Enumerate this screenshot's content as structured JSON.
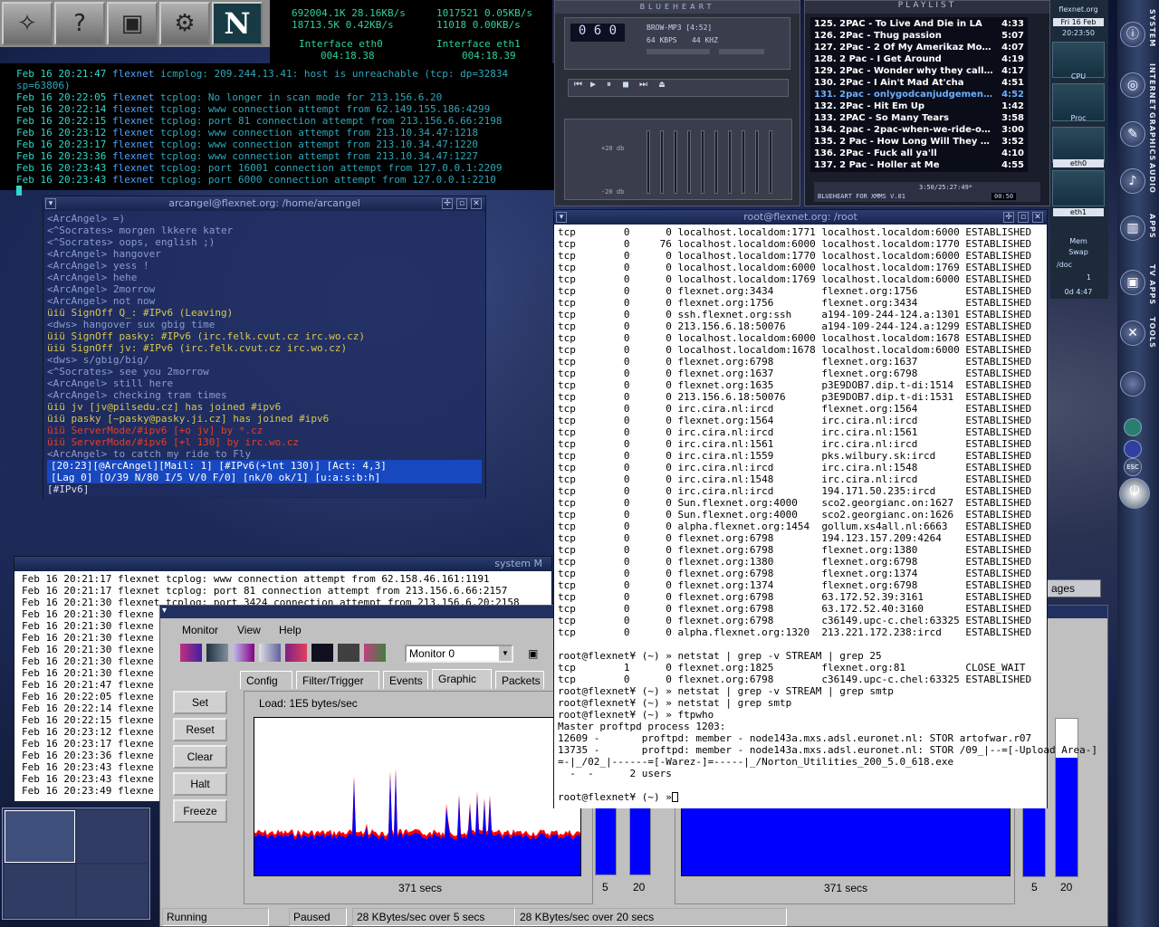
{
  "launcher": {
    "items": [
      {
        "icon": "foot-icon",
        "glyph": "✧"
      },
      {
        "icon": "help-icon",
        "glyph": "?"
      },
      {
        "icon": "terminal-icon",
        "glyph": "▣"
      },
      {
        "icon": "settings-icon",
        "glyph": "⚙"
      },
      {
        "icon": "netscape-icon",
        "glyph": "N"
      }
    ]
  },
  "netmon": {
    "eth0": {
      "l1": "692004.1K   28.16KB/s",
      "l2": "18713.5K   0.42KB/s",
      "label": "Interface  eth0",
      "time": "004:18.38"
    },
    "eth1": {
      "l1": "1017521   0.05KB/s",
      "l2": "11018   0.00KB/s",
      "label": "Interface  eth1",
      "time": "004:18.39"
    }
  },
  "tcplog": [
    {
      "d": "Feb 16 20:21:47",
      "h": "flexnet",
      "m": "icmplog: 209.244.13.41: host is unreachable (tcp: dp=32834 sp=63806)"
    },
    {
      "d": "Feb 16 20:22:05",
      "h": "flexnet",
      "m": "tcplog: No longer in scan mode for 213.156.6.20"
    },
    {
      "d": "Feb 16 20:22:14",
      "h": "flexnet",
      "m": "tcplog: www connection attempt from 62.149.155.186:4299"
    },
    {
      "d": "Feb 16 20:22:15",
      "h": "flexnet",
      "m": "tcplog: port 81 connection attempt from 213.156.6.66:2198"
    },
    {
      "d": "Feb 16 20:23:12",
      "h": "flexnet",
      "m": "tcplog: www connection attempt from 213.10.34.47:1218"
    },
    {
      "d": "Feb 16 20:23:17",
      "h": "flexnet",
      "m": "tcplog: www connection attempt from 213.10.34.47:1220"
    },
    {
      "d": "Feb 16 20:23:36",
      "h": "flexnet",
      "m": "tcplog: www connection attempt from 213.10.34.47:1227"
    },
    {
      "d": "Feb 16 20:23:43",
      "h": "flexnet",
      "m": "tcplog: port 16001 connection attempt from 127.0.0.1:2209"
    },
    {
      "d": "Feb 16 20:23:43",
      "h": "flexnet",
      "m": "tcplog: port 6000 connection attempt from 127.0.0.1:2210"
    }
  ],
  "irc": {
    "title": "arcangel@flexnet.org: /home/arcangel",
    "lines": [
      {
        "c": "nick",
        "t": "<ArcAngel> =)"
      },
      {
        "c": "nick",
        "t": "<^Socrates> morgen lkkere kater"
      },
      {
        "c": "nick",
        "t": "<^Socrates> oops, english ;)"
      },
      {
        "c": "nick",
        "t": "<ArcAngel> hangover"
      },
      {
        "c": "nick",
        "t": "<ArcAngel> yess !"
      },
      {
        "c": "nick",
        "t": "<ArcAngel> hehe"
      },
      {
        "c": "nick",
        "t": "<ArcAngel> 2morrow"
      },
      {
        "c": "nick",
        "t": "<ArcAngel> not now"
      },
      {
        "c": "yel",
        "t": "üiü SignOff Q_: #IPv6 (Leaving)"
      },
      {
        "c": "nick",
        "t": "<dws> hangover sux gbig time"
      },
      {
        "c": "yel",
        "t": "üiü SignOff pasky: #IPv6 (irc.felk.cvut.cz irc.wo.cz)"
      },
      {
        "c": "yel",
        "t": "üiü SignOff jv: #IPv6 (irc.felk.cvut.cz irc.wo.cz)"
      },
      {
        "c": "nick",
        "t": "<dws> s/gbig/big/"
      },
      {
        "c": "nick",
        "t": "<^Socrates> see you 2morrow"
      },
      {
        "c": "nick",
        "t": "<ArcAngel> still here"
      },
      {
        "c": "nick",
        "t": "<ArcAngel> checking tram times"
      },
      {
        "c": "yel",
        "t": "üiü jv [jv@pilsedu.cz] has joined #ipv6"
      },
      {
        "c": "yel",
        "t": "üiü pasky [~pasky@pasky.ji.cz] has joined #ipv6"
      },
      {
        "c": "red",
        "t": "üiü ServerMode/#ipv6 [+o jv] by *.cz"
      },
      {
        "c": "red",
        "t": "üiü ServerMode/#ipv6 [+l 130] by irc.wo.cz"
      },
      {
        "c": "nick",
        "t": "<ArcAngel> to catch my ride to Fly"
      }
    ],
    "status1": " [20:23][@ArcAngel][Mail: 1] [#IPv6(+lnt 130)]   [Act: 4,3]",
    "status2": " [Lag  0] [O/39 N/80 I/5 V/0 F/0] [nk/0 ok/1]          [u:a:s:b:h]",
    "input": "[#IPv6] "
  },
  "root": {
    "title": "root@flexnet.org: /root",
    "netstat": [
      "tcp        0      0 localhost.localdom:1771 localhost.localdom:6000 ESTABLISHED",
      "tcp        0     76 localhost.localdom:6000 localhost.localdom:1770 ESTABLISHED",
      "tcp        0      0 localhost.localdom:1770 localhost.localdom:6000 ESTABLISHED",
      "tcp        0      0 localhost.localdom:6000 localhost.localdom:1769 ESTABLISHED",
      "tcp        0      0 localhost.localdom:1769 localhost.localdom:6000 ESTABLISHED",
      "tcp        0      0 flexnet.org:3434        flexnet.org:1756        ESTABLISHED",
      "tcp        0      0 flexnet.org:1756        flexnet.org:3434        ESTABLISHED",
      "tcp        0      0 ssh.flexnet.org:ssh     a194-109-244-124.a:1301 ESTABLISHED",
      "tcp        0      0 213.156.6.18:50076      a194-109-244-124.a:1299 ESTABLISHED",
      "tcp        0      0 localhost.localdom:6000 localhost.localdom:1678 ESTABLISHED",
      "tcp        0      0 localhost.localdom:1678 localhost.localdom:6000 ESTABLISHED",
      "tcp        0      0 flexnet.org:6798        flexnet.org:1637        ESTABLISHED",
      "tcp        0      0 flexnet.org:1637        flexnet.org:6798        ESTABLISHED",
      "tcp        0      0 flexnet.org:1635        p3E9DOB7.dip.t-di:1514  ESTABLISHED",
      "tcp        0      0 213.156.6.18:50076      p3E9DOB7.dip.t-di:1531  ESTABLISHED",
      "tcp        0      0 irc.cira.nl:ircd        flexnet.org:1564        ESTABLISHED",
      "tcp        0      0 flexnet.org:1564        irc.cira.nl:ircd        ESTABLISHED",
      "tcp        0      0 irc.cira.nl:ircd        irc.cira.nl:1561        ESTABLISHED",
      "tcp        0      0 irc.cira.nl:1561        irc.cira.nl:ircd        ESTABLISHED",
      "tcp        0      0 irc.cira.nl:1559        pks.wilbury.sk:ircd     ESTABLISHED",
      "tcp        0      0 irc.cira.nl:ircd        irc.cira.nl:1548        ESTABLISHED",
      "tcp        0      0 irc.cira.nl:1548        irc.cira.nl:ircd        ESTABLISHED",
      "tcp        0      0 irc.cira.nl:ircd        194.171.50.235:ircd     ESTABLISHED",
      "tcp        0      0 Sun.flexnet.org:4000    sco2.georgianc.on:1627  ESTABLISHED",
      "tcp        0      0 Sun.flexnet.org:4000    sco2.georgianc.on:1626  ESTABLISHED",
      "tcp        0      0 alpha.flexnet.org:1454  gollum.xs4all.nl:6663   ESTABLISHED",
      "tcp        0      0 flexnet.org:6798        194.123.157.209:4264    ESTABLISHED",
      "tcp        0      0 flexnet.org:6798        flexnet.org:1380        ESTABLISHED",
      "tcp        0      0 flexnet.org:1380        flexnet.org:6798        ESTABLISHED",
      "tcp        0      0 flexnet.org:6798        flexnet.org:1374        ESTABLISHED",
      "tcp        0      0 flexnet.org:1374        flexnet.org:6798        ESTABLISHED",
      "tcp        0      0 flexnet.org:6798        63.172.52.39:3161       ESTABLISHED",
      "tcp        0      0 flexnet.org:6798        63.172.52.40:3160       ESTABLISHED",
      "tcp        0      0 flexnet.org:6798        c36149.upc-c.chel:63325 ESTABLISHED",
      "tcp        0      0 alpha.flexnet.org:1320  213.221.172.238:ircd    ESTABLISHED",
      "",
      "root@flexnet¥ (~) » netstat | grep -v STREAM | grep 25",
      "tcp        1      0 flexnet.org:1825        flexnet.org:81          CLOSE_WAIT",
      "tcp        0      0 flexnet.org:6798        c36149.upc-c.chel:63325 ESTABLISHED",
      "root@flexnet¥ (~) » netstat | grep -v STREAM | grep smtp",
      "root@flexnet¥ (~) » netstat | grep smtp",
      "root@flexnet¥ (~) » ftpwho",
      "Master proftpd process 1203:",
      "12609 -       proftpd: member - node143a.mxs.adsl.euronet.nl: STOR artofwar.r07",
      "13735 -       proftpd: member - node143a.mxs.adsl.euronet.nl: STOR /09_|--=[-Upload Area-]",
      "=-|_/02_|------=[-Warez-]=-----|_/Norton_Utilities_200_5.0_618.exe",
      "  -  -      2 users",
      "",
      "root@flexnet¥ (~) » "
    ]
  },
  "sysmon": {
    "title": "system M",
    "lines": [
      "Feb 16 20:21:17 flexnet tcplog: www connection attempt from 62.158.46.161:1191",
      "Feb 16 20:21:17 flexnet tcplog: port 81 connection attempt from 213.156.6.66:2157",
      "Feb 16 20:21:30 flexnet tcplog: port 3424 connection attempt from 213.156.6.20:2158",
      "Feb 16 20:21:30 flexne",
      "Feb 16 20:21:30 flexne",
      "Feb 16 20:21:30 flexne",
      "Feb 16 20:21:30 flexne",
      "Feb 16 20:21:30 flexne",
      "Feb 16 20:21:30 flexne",
      "Feb 16 20:21:47 flexne",
      "Feb 16 20:22:05 flexne",
      "Feb 16 20:22:14 flexne",
      "Feb 16 20:22:15 flexne",
      "Feb 16 20:23:12 flexne",
      "Feb 16 20:23:17 flexne",
      "Feb 16 20:23:36 flexne",
      "Feb 16 20:23:43 flexne",
      "Feb 16 20:23:43 flexne",
      "Feb 16 20:23:49 flexne"
    ]
  },
  "monitor": {
    "menu": [
      "Monitor",
      "View",
      "Help"
    ],
    "select": "Monitor 0",
    "tabs": [
      "Config",
      "Filter/Trigger",
      "Events",
      "Graphic",
      "Packets"
    ],
    "active_tab": "Graphic",
    "buttons": [
      "Set",
      "Reset",
      "Clear",
      "Halt",
      "Freeze"
    ],
    "graph_label": "Load: 1E5 bytes/sec",
    "xlabel": "371 secs",
    "xlabel2": "371 secs",
    "bar_labels": [
      "5",
      "20"
    ],
    "bar_labels2": [
      "5",
      "20"
    ],
    "status": [
      "Running",
      "Paused",
      "28 KBytes/sec over 5 secs",
      "28 KBytes/sec over 20 secs"
    ],
    "partial_label": "ages",
    "mini_levels": [
      0.55,
      0.55
    ],
    "mini_levels2": [
      0.55,
      0.75
    ],
    "colors": {
      "series_a": "#0000ff",
      "series_b": "#ff0000",
      "panel": "#c0c0c0"
    }
  },
  "winamp": {
    "title": "BLUEHEART",
    "time": "0 6 0",
    "song_info": "BROW-MP3 [4:52]",
    "kbps": "64 KBPS",
    "khz": "44 KHZ",
    "eq_db_top": "+20 db",
    "eq_db_bot": "-20 db",
    "eq_letters": "PREAMP",
    "status": "3:50/25:27:49*",
    "skin": "BLUEHEART FOR XMMS V.01",
    "counter": "00:50"
  },
  "playlist": {
    "title": "PLAYLIST",
    "items": [
      {
        "t": "125. 2PAC - To Live And Die in LA",
        "d": "4:33"
      },
      {
        "t": "126. 2Pac - Thug passion",
        "d": "5:07"
      },
      {
        "t": "127. 2Pac - 2 Of My Amerikaz Most Wan...",
        "d": "4:07"
      },
      {
        "t": "128. 2 Pac - I Get Around",
        "d": "4:19"
      },
      {
        "t": "129. 2Pac - Wonder why they call u bitch",
        "d": "4:17"
      },
      {
        "t": "130. 2Pac - I Ain't Mad At'cha",
        "d": "4:51"
      },
      {
        "t": "131. 2pac - onlygodcanjudgemenow.mp3",
        "d": "4:52",
        "cur": true
      },
      {
        "t": "132. 2Pac - Hit Em Up",
        "d": "1:42"
      },
      {
        "t": "133. 2PAC - So Many Tears",
        "d": "3:58"
      },
      {
        "t": "134. 2pac - 2pac-when-we-ride-on-our...",
        "d": "3:00"
      },
      {
        "t": "135. 2 Pac - How Long Will They Mourn...",
        "d": "3:52"
      },
      {
        "t": "136. 2Pac - Fuck all ya'll",
        "d": "4:10"
      },
      {
        "t": "137. 2 Pac - Holler at Me",
        "d": "4:55"
      }
    ]
  },
  "sysinfo": {
    "host": "flexnet.org",
    "date": "Fri 16 Feb",
    "time": "20:23:50",
    "cpu": "CPU",
    "proc": "Proc",
    "eth0": "eth0",
    "eth1": "eth1",
    "mem": "Mem",
    "swap": "Swap",
    "doc": "/doc",
    "one": "1",
    "uptime": "0d 4:47"
  },
  "dock": {
    "labels": [
      "SYSTEM",
      "INTERNET",
      "GRAPHICS",
      "AUDIO",
      "APPS",
      "TV APPS",
      "TOOLS"
    ],
    "esc": "ESC"
  }
}
